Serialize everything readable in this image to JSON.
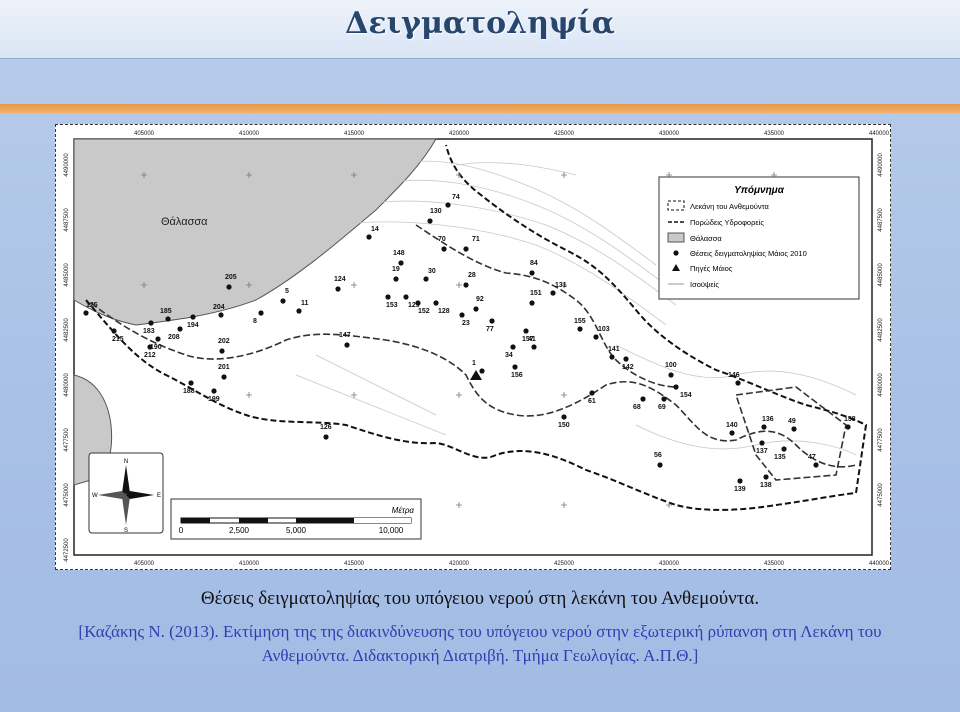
{
  "slide": {
    "title": "Δειγματοληψία"
  },
  "map": {
    "sea_label": "Θάλασσα",
    "legend": {
      "title": "Υπόμνημα",
      "items": [
        {
          "label": "Λεκάνη του Ανθεμούντα",
          "symbol": "dashed-box"
        },
        {
          "label": "Πορώδεις Υδροφορείς",
          "symbol": "dashed-line"
        },
        {
          "label": "Θάλασσα",
          "symbol": "grey-box"
        },
        {
          "label": "Θέσεις δειγματοληψίας Μάιος 2010",
          "symbol": "dot"
        },
        {
          "label": "Πηγές Μάιος",
          "symbol": "triangle"
        },
        {
          "label": "Ισοϋψείς",
          "symbol": "line"
        }
      ]
    },
    "x_ticks": [
      "405000",
      "410000",
      "415000",
      "420000",
      "425000",
      "430000",
      "435000",
      "440000"
    ],
    "y_ticks_left": [
      "4490000",
      "4487500",
      "4485000",
      "4482500",
      "4480000",
      "4477500",
      "4475000",
      "4472500"
    ],
    "y_ticks_right": [
      "4490000",
      "4487500",
      "4485000",
      "4482500",
      "4480000",
      "4477500",
      "4475000"
    ],
    "scale": {
      "unit": "Μέτρα",
      "labels": [
        "0",
        "2,500",
        "5,000",
        "10,000"
      ]
    },
    "compass": [
      "N",
      "S",
      "E",
      "W"
    ],
    "site_ids": [
      "74",
      "130",
      "14",
      "70",
      "71",
      "148",
      "84",
      "124",
      "19",
      "30",
      "28",
      "131",
      "153",
      "129",
      "152",
      "128",
      "205",
      "151",
      "92",
      "125",
      "5",
      "11",
      "23",
      "185",
      "183",
      "194",
      "204",
      "8",
      "77",
      "155",
      "215",
      "208",
      "202",
      "157",
      "103",
      "190",
      "147",
      "34",
      "141",
      "142",
      "212",
      "41",
      "1",
      "156",
      "201",
      "100",
      "188",
      "154",
      "199",
      "61",
      "68",
      "69",
      "146",
      "150",
      "136",
      "140",
      "49",
      "126",
      "158",
      "137",
      "135",
      "56",
      "47",
      "139",
      "138"
    ]
  },
  "caption": {
    "main": "Θέσεις δειγματοληψίας του υπόγειου νερού στη λεκάνη του Ανθεμούντα.",
    "reference": "[Καζάκης Ν. (2013). Εκτίμηση της  της διακινδύνευσης του υπόγειου νερού στην εξωτερική ρύπανση στη Λεκάνη του Ανθεμούντα. Διδακτορική Διατριβή. Τμήμα Γεωλογίας. Α.Π.Θ.]"
  }
}
